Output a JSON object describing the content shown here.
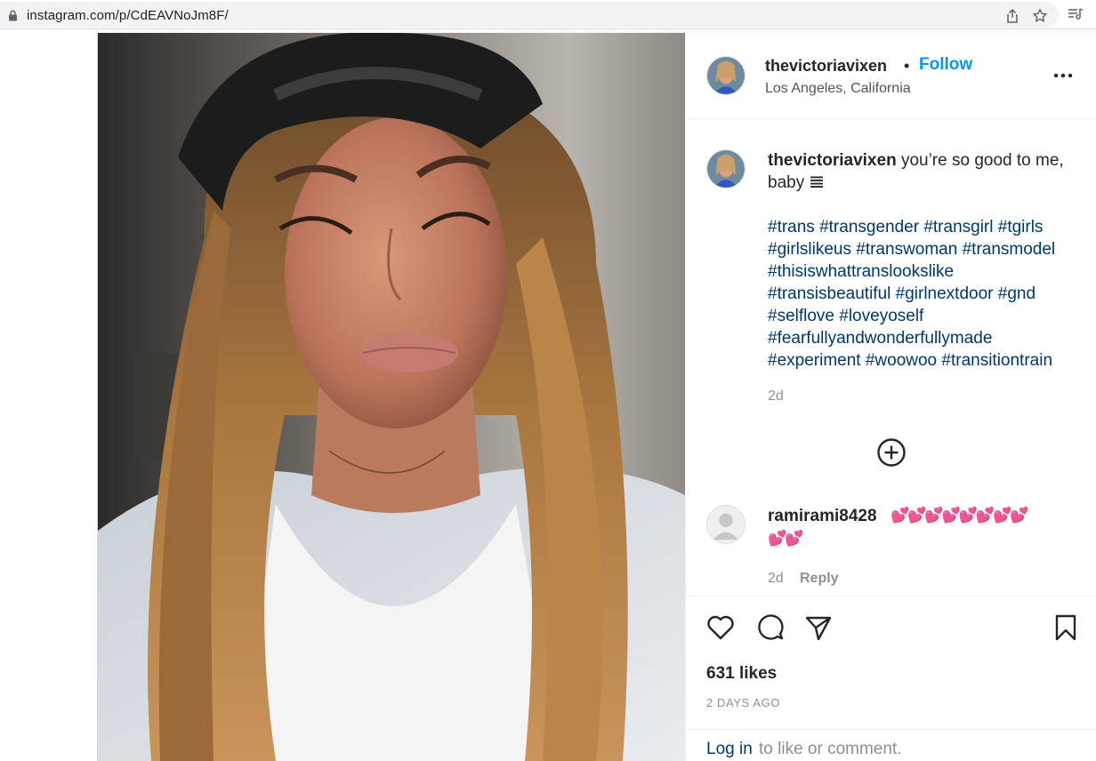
{
  "browser": {
    "url": "instagram.com/p/CdEAVNoJm8F/"
  },
  "post": {
    "author": "thevictoriavixen",
    "follow_label": "Follow",
    "separator": "•",
    "location": "Los Angeles, California",
    "caption_text": "you’re so good to me, baby 𝌆",
    "hashtag_lines": [
      "#trans #transgender #transgirl #tgirls",
      "#girlslikeus #transwoman #transmodel",
      "#thisiswhattranslookslike",
      "#transisbeautiful #girlnextdoor #gnd",
      "#selflove #loveyoself",
      "#fearfullyandwonderfullymade",
      "#experiment #woowoo #transitiontrain"
    ],
    "caption_time": "2d"
  },
  "comment": {
    "user": "ramirami8428",
    "hearts_line1": "💕💕💕💕💕💕💕💕",
    "hearts_line2": "💕💕",
    "time": "2d",
    "reply_label": "Reply"
  },
  "stats": {
    "likes": "631 likes",
    "posted": "2 DAYS AGO"
  },
  "login": {
    "link": "Log in",
    "rest": "to like or comment."
  },
  "icons": {
    "lock": "lock-icon",
    "share": "share-icon",
    "bookmark_star": "star-icon",
    "reading_list": "reading-list-icon",
    "more": "more-options-icon",
    "load_more": "plus-circle-icon",
    "like": "heart-icon",
    "comment": "comment-icon",
    "share_post": "paper-plane-icon",
    "save": "bookmark-icon"
  },
  "colors": {
    "follow": "#0095f6",
    "hashtag": "#00376b",
    "muted": "#8e8e8e",
    "hearts": "#ff3da8"
  }
}
